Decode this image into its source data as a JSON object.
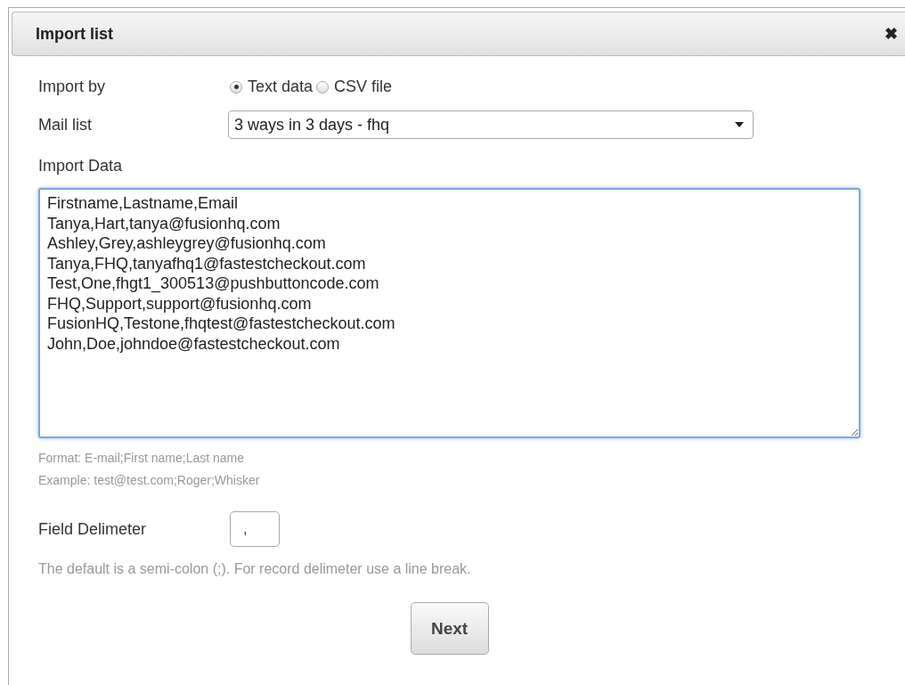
{
  "dialog": {
    "title": "Import list",
    "close": "✖"
  },
  "import_by": {
    "label": "Import by",
    "options": [
      {
        "label": "Text data",
        "selected": true
      },
      {
        "label": "CSV file",
        "selected": false
      }
    ]
  },
  "mail_list": {
    "label": "Mail list",
    "value": "3 ways in 3 days - fhq"
  },
  "import_data": {
    "label": "Import Data",
    "value": "Firstname,Lastname,Email\nTanya,Hart,tanya@fusionhq.com\nAshley,Grey,ashleygrey@fusionhq.com\nTanya,FHQ,tanyafhq1@fastestcheckout.com\nTest,One,fhgt1_300513@pushbuttoncode.com\nFHQ,Support,support@fusionhq.com\nFusionHQ,Testone,fhqtest@fastestcheckout.com\nJohn,Doe,johndoe@fastestcheckout.com",
    "hints": [
      "Format: E-mail;First name;Last name",
      "Example: test@test.com;Roger;Whisker"
    ]
  },
  "field_delimiter": {
    "label": "Field Delimeter",
    "value": ",",
    "hint": "The default is a semi-colon (;). For record delimeter use a line break."
  },
  "buttons": [
    "Next"
  ]
}
